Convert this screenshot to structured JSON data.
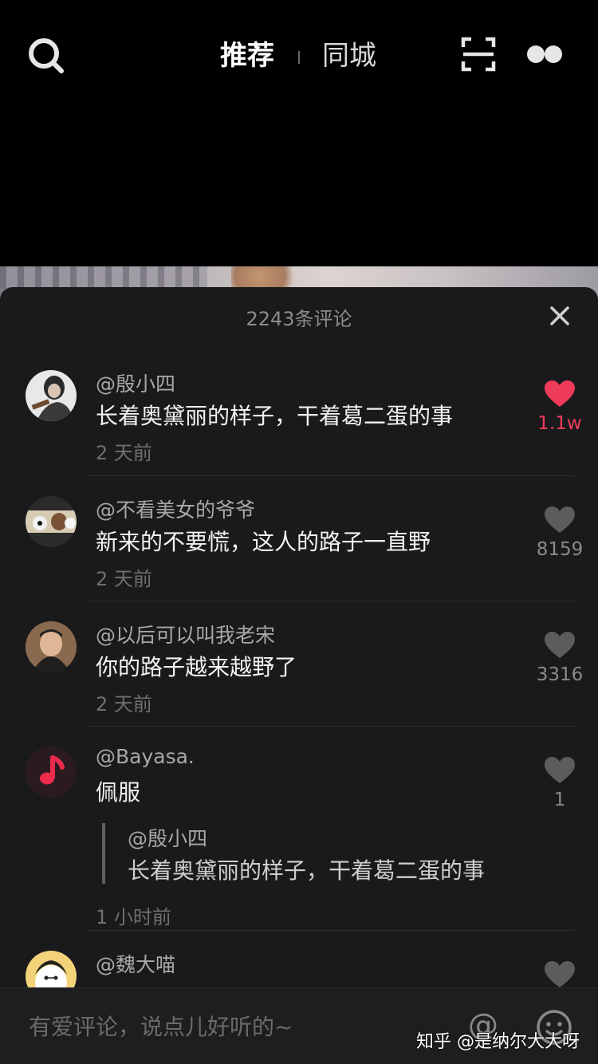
{
  "top_nav": {
    "tab_recommend": "推荐",
    "tab_city": "同城",
    "icons": {
      "search": "search-icon",
      "scan": "scan-icon",
      "more": "more-icon"
    }
  },
  "comments_sheet": {
    "title": "2243条评论",
    "close_icon": "close-icon",
    "comments": [
      {
        "user": "@殷小四",
        "text": "长着奥黛丽的样子，干着葛二蛋的事",
        "time": "2 天前",
        "likes": "1.1w",
        "liked": true
      },
      {
        "user": "@不看美女的爷爷",
        "text": "新来的不要慌，这人的路子一直野",
        "time": "2 天前",
        "likes": "8159",
        "liked": false
      },
      {
        "user": "@以后可以叫我老宋",
        "text": "你的路子越来越野了",
        "time": "2 天前",
        "likes": "3316",
        "liked": false
      },
      {
        "user": "@Bayasa.",
        "text": "佩服",
        "time": "1 小时前",
        "likes": "1",
        "liked": false,
        "reply_to": {
          "user": "@殷小四",
          "text": "长着奥黛丽的样子，干着葛二蛋的事"
        }
      },
      {
        "user": "@魏大喵",
        "text": "",
        "time": "",
        "likes": "",
        "liked": false
      }
    ]
  },
  "input_bar": {
    "placeholder": "有爱评论，说点儿好听的~",
    "at_symbol": "@",
    "emoji_icon": "emoji-icon"
  },
  "watermark": "知乎 @是纳尔大大呀",
  "colors": {
    "like_active": "#ee3b5a",
    "sheet_bg": "#1a1a1c"
  }
}
